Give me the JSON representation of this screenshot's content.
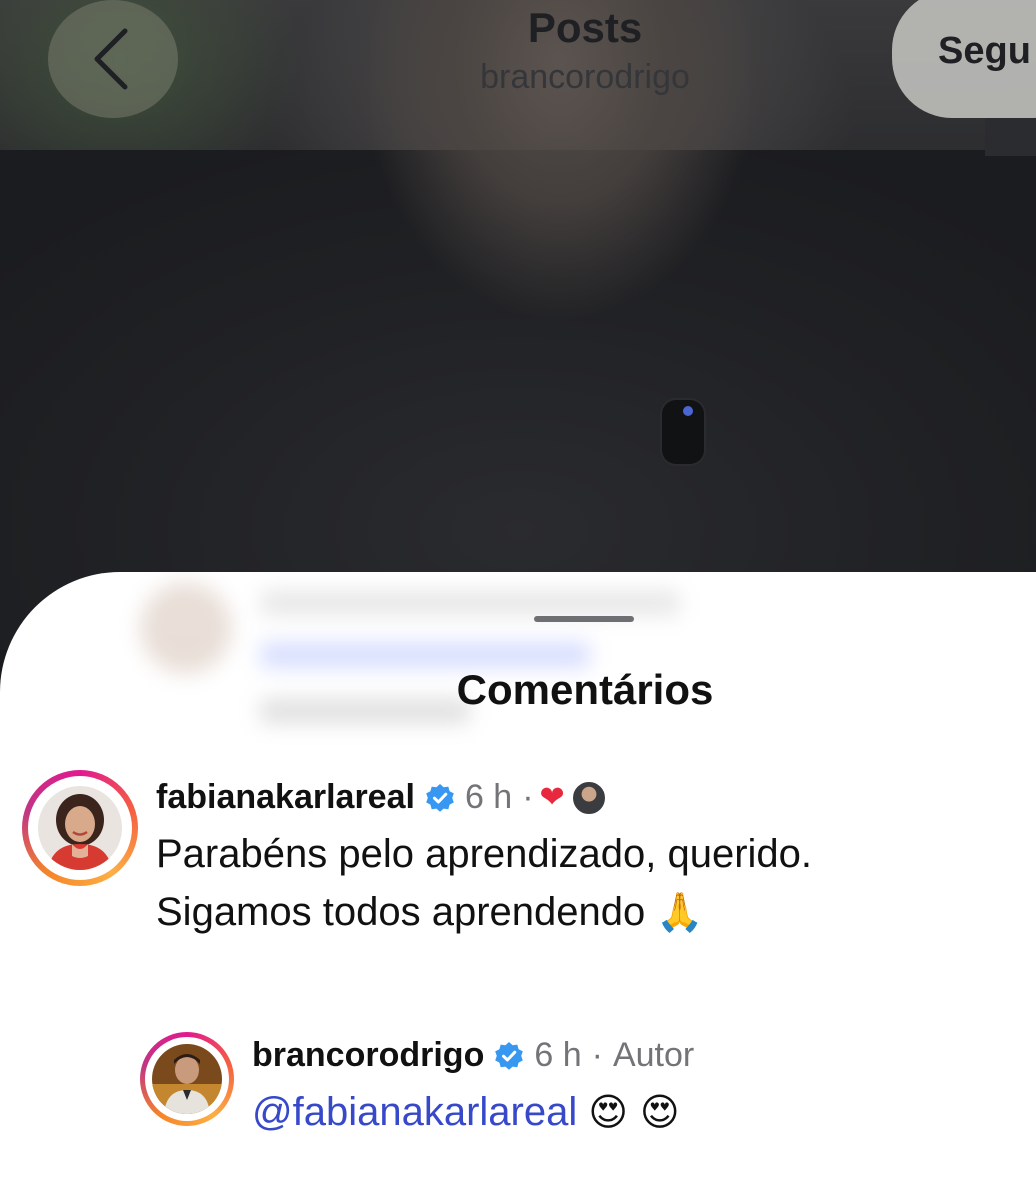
{
  "header": {
    "title": "Posts",
    "subtitle": "brancorodrigo",
    "follow_label": "Segu"
  },
  "sheet": {
    "title": "Comentários"
  },
  "comments": [
    {
      "username": "fabianakarlareal",
      "time": "6 h",
      "separator": "·",
      "liked_by_author": true,
      "text_lines": [
        "Parabéns pelo aprendizado, querido.",
        "Sigamos todos aprendendo"
      ],
      "emoji": "🙏"
    }
  ],
  "replies": [
    {
      "username": "brancorodrigo",
      "time": "6 h",
      "separator": "·",
      "badge": "Autor",
      "mention": "@fabianakarlareal",
      "emojis": "😍 😍"
    }
  ],
  "colors": {
    "verified": "#3897f0",
    "mention": "#3749c9",
    "heart": "#e8283d",
    "muted": "#737478"
  }
}
